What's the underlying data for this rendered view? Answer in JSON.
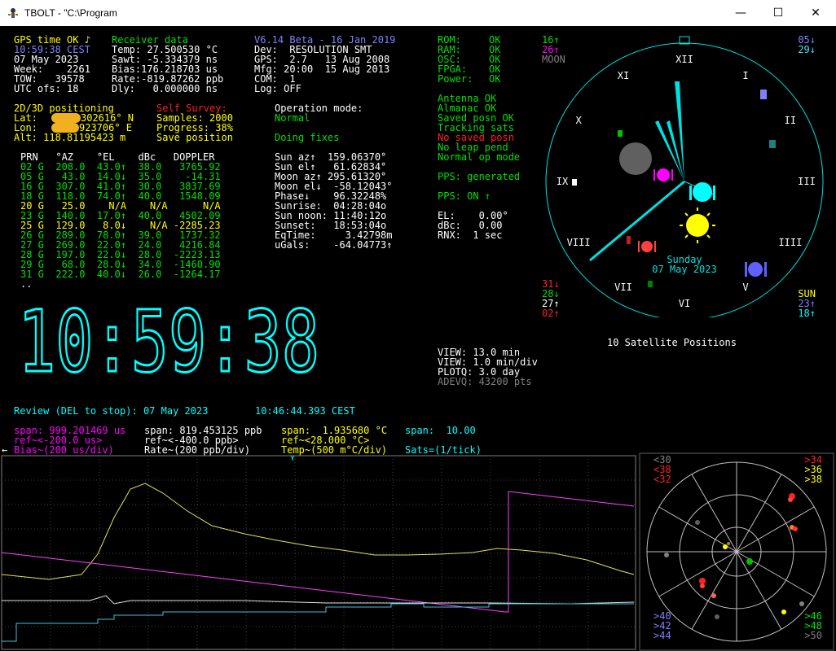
{
  "window": {
    "title": "TBOLT - \"C:\\Program",
    "min": "—",
    "max": "☐",
    "close": "✕"
  },
  "gps": {
    "status": "GPS time OK ♪",
    "time": "10:59:38 CEST",
    "date": "07 May 2023",
    "week": "Week:    2261",
    "tow": "TOW:   39578",
    "utc": "UTC ofs: 18"
  },
  "receiver": {
    "title": "Receiver data",
    "temp": "Temp: 27.500530 °C",
    "sawt": "Sawt: -5.334379 ns",
    "bias": "Bias:176.218703 us",
    "rate": "Rate:-819.87262 ppb",
    "dly": "Dly:   0.000000 ns"
  },
  "device": {
    "ver": "V6.14 Beta - 16 Jan 2019",
    "dev": "Dev:  RESOLUTION SMT",
    "gps": "GPS:  2.7   13 Aug 2008",
    "mfg": "Mfg: 20:00  15 Aug 2013",
    "com": "COM:  1",
    "log": "Log: OFF"
  },
  "status": {
    "rom": "ROM:",
    "rom_v": "OK",
    "ram": "RAM:",
    "ram_v": "OK",
    "osc": "OSC:",
    "osc_v": "OK",
    "fpga": "FPGA:",
    "fpga_v": "OK",
    "power": "Power:",
    "power_v": "OK",
    "list": [
      "Antenna OK",
      "Almanac OK",
      "Saved posn OK",
      "Tracking sats"
    ],
    "red_list": [
      "No saved posn"
    ],
    "list2": [
      "No leap pend",
      "Normal op mode"
    ],
    "pps": "PPS: generated",
    "pps2": "PPS: ON ↑",
    "el": "EL:    0.00°",
    "dbc": "dBc:   0.00",
    "rnx": "RNX:  1 sec"
  },
  "pos": {
    "title": "2D/3D positioning",
    "lat": "Lat:  ",
    "lat_v": "302616° N",
    "lon": "Lon:  ",
    "lon_v": "923706° E",
    "alt": "Alt: 118.81195423 m"
  },
  "survey": {
    "title": "Self Survey:",
    "samples": "Samples: 2000",
    "progress": "Progress: 38%",
    "save": "Save position"
  },
  "opmode": {
    "title": "Operation mode:",
    "mode": "Normal",
    "fixes": "Doing fixes"
  },
  "table": {
    "header": "PRN   °AZ    °EL    dBc   DOPPLER",
    "rows": [
      {
        "t": "02 G  208.0  43.0↑  38.0   3765.92",
        "c": "g"
      },
      {
        "t": "05 G   43.0  14.0↓  35.0    -14.31",
        "c": "g"
      },
      {
        "t": "16 G  307.0  41.0↑  30.0   3837.69",
        "c": "g"
      },
      {
        "t": "18 G  118.0  74.0↑  40.0   1548.09",
        "c": "g"
      },
      {
        "t": "20 G   25.0    N/A    N/A      N/A",
        "c": "y"
      },
      {
        "t": "23 G  140.0  17.0↑  40.0   4502.09",
        "c": "g"
      },
      {
        "t": "25 G  129.0   8.0↓    N/A -2285.23",
        "c": "y"
      },
      {
        "t": "26 G  289.0  78.0↑  39.0   1737.32",
        "c": "g"
      },
      {
        "t": "27 G  269.0  22.0↑  24.0   4216.84",
        "c": "g"
      },
      {
        "t": "28 G  197.0  22.0↓  28.0  -2223.13",
        "c": "g"
      },
      {
        "t": "29 G   68.0  28.0↓  34.0  -1460.90",
        "c": "g"
      },
      {
        "t": "31 G  222.0  40.0↓  26.0  -1264.17",
        "c": "g"
      }
    ],
    "more": ".."
  },
  "sun": {
    "az": "Sun az↑  159.06370°",
    "el": "Sun el↑   61.62834°",
    "maz": "Moon az↑ 295.61320°",
    "mel": "Moon el↓  -58.12043°",
    "phase": "Phase↓    96.32248%",
    "rise": "Sunrise:  04:28:04o",
    "noon": "Sun noon: 11:40:12o",
    "set": "Sunset:   18:53:04o",
    "eq": "EqTime:     3.42798m",
    "ugals": "uGals:    -64.04773↑"
  },
  "clock": "10:59:38",
  "view": {
    "a": "VIEW: 13.0 min",
    "b": "VIEW: 1.0 min/div",
    "c": "PLOTQ: 3.0 day",
    "d": "ADEVQ: 43200 pts"
  },
  "review": {
    "text": "Review (DEL to stop): 07 May 2023",
    "time": "10:46:44.393 CEST"
  },
  "spans": {
    "s1": "span: 999.201469 us",
    "s2": "span: 819.453125 ppb",
    "s3": "span:  1.935680 °C",
    "s4": "span:  10.00",
    "r1": "ref~<-200.0 us>",
    "r2": "ref~<-400.0 ppb>",
    "r3": "ref~<28.000 °C>",
    "l1": "Bias~(200 us/div)",
    "l2": "Rate~(200 ppb/div)",
    "l3": "Temp~(500 m°C/div)",
    "l4": "Sats=(1/tick)"
  },
  "sky": {
    "title": "10 Satellite Positions",
    "day": "Sunday",
    "date": "07 May 2023",
    "tl": [
      {
        "t": "16↑",
        "c": "g"
      },
      {
        "t": "26↑",
        "c": "m"
      },
      {
        "t": "MOON",
        "c": "gr"
      }
    ],
    "tr": [
      {
        "t": "05↓",
        "c": "lb"
      },
      {
        "t": "29↓",
        "c": "cy2"
      }
    ],
    "bl": [
      {
        "t": "31↓",
        "c": "r"
      },
      {
        "t": "28↓",
        "c": "g"
      },
      {
        "t": "27↑",
        "c": "w"
      },
      {
        "t": "02↑",
        "c": "r"
      }
    ],
    "br": [
      {
        "t": "SUN",
        "c": "y"
      },
      {
        "t": "23↑",
        "c": "lb"
      },
      {
        "t": "18↑",
        "c": "c"
      }
    ],
    "hours": [
      "XII",
      "I",
      "II",
      "III",
      "IIII",
      "V",
      "VI",
      "VII",
      "VIII",
      "IX",
      "X",
      "XI"
    ]
  },
  "mini": {
    "tl": [
      {
        "t": "<30",
        "c": "gr"
      },
      {
        "t": "<38",
        "c": "r"
      },
      {
        "t": "<32",
        "c": "r"
      }
    ],
    "tr": [
      {
        "t": ">34",
        "c": "r"
      },
      {
        "t": ">36",
        "c": "y"
      },
      {
        "t": ">38",
        "c": "y"
      }
    ],
    "bl": [
      {
        "t": ">40",
        "c": "lb"
      },
      {
        "t": ">42",
        "c": "lb"
      },
      {
        "t": ">44",
        "c": "lb"
      }
    ],
    "br": [
      {
        "t": ">46",
        "c": "g"
      },
      {
        "t": ">48",
        "c": "g"
      },
      {
        "t": ">50",
        "c": "gr"
      }
    ]
  }
}
